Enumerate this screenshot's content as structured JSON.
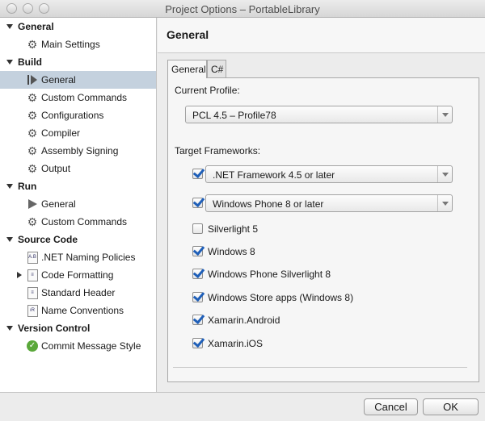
{
  "window": {
    "title": "Project Options – PortableLibrary"
  },
  "sidebar": {
    "categories": {
      "general": "General",
      "build": "Build",
      "run": "Run",
      "source_code": "Source Code",
      "version_control": "Version Control"
    },
    "items": {
      "main_settings": "Main Settings",
      "build_general": "General",
      "build_custom_commands": "Custom Commands",
      "configurations": "Configurations",
      "compiler": "Compiler",
      "assembly_signing": "Assembly Signing",
      "output": "Output",
      "run_general": "General",
      "run_custom_commands": "Custom Commands",
      "naming_policies": ".NET Naming Policies",
      "code_formatting": "Code Formatting",
      "standard_header": "Standard Header",
      "name_conventions": "Name Conventions",
      "commit_message_style": "Commit Message Style"
    },
    "selected": "build_general"
  },
  "main": {
    "title": "General",
    "tabs": {
      "general": "General",
      "csharp": "C#"
    },
    "current_profile_label": "Current Profile:",
    "current_profile_value": "PCL 4.5 – Profile78",
    "target_frameworks_label": "Target Frameworks:",
    "frameworks": {
      "net": {
        "label": ".NET Framework 4.5 or later",
        "checked": true
      },
      "wp": {
        "label": "Windows Phone 8 or later",
        "checked": true
      },
      "silverlight": {
        "label": "Silverlight 5",
        "checked": false
      },
      "windows8": {
        "label": "Windows 8",
        "checked": true
      },
      "wp_silverlight": {
        "label": "Windows Phone Silverlight 8",
        "checked": true
      },
      "store": {
        "label": "Windows Store apps (Windows 8)",
        "checked": true
      },
      "android": {
        "label": "Xamarin.Android",
        "checked": true
      },
      "ios": {
        "label": "Xamarin.iOS",
        "checked": true
      }
    }
  },
  "buttons": {
    "cancel": "Cancel",
    "ok": "OK"
  },
  "colors": {
    "selection": "#c4d1de",
    "checkmark": "#1f5fb8",
    "commit_icon": "#5aa83a"
  }
}
